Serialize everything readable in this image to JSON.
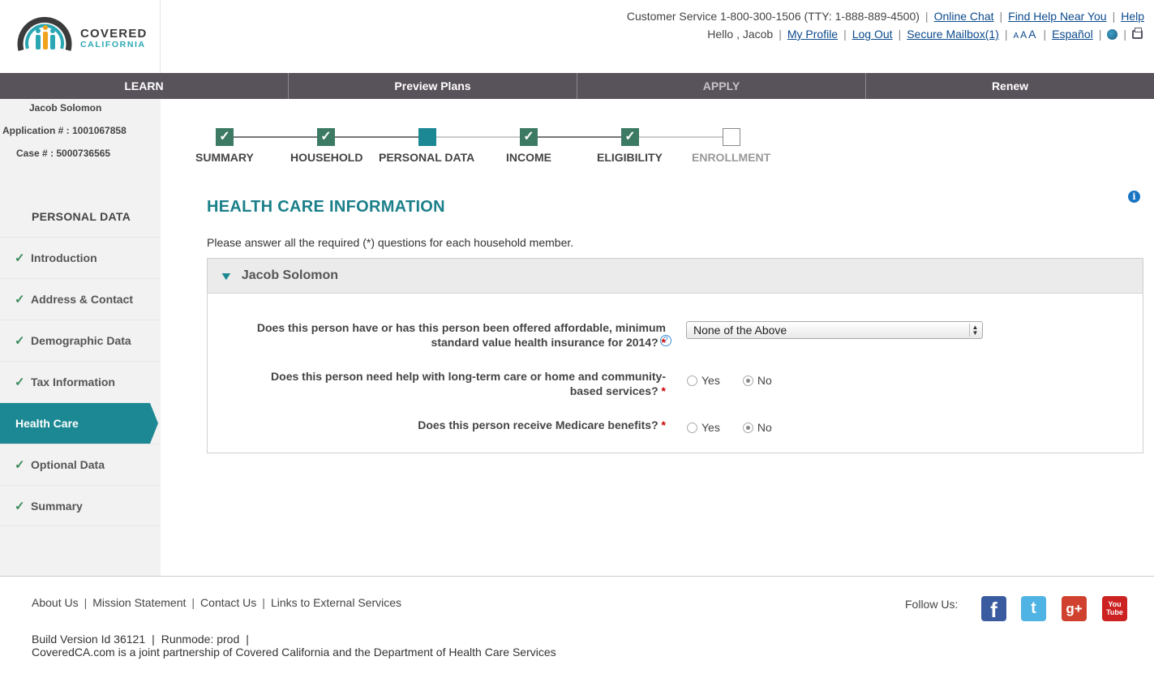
{
  "logo": {
    "line1": "COVERED",
    "line2": "CALIFORNIA"
  },
  "topbar": {
    "customer_service": "Customer Service 1-800-300-1506 (TTY: 1-888-889-4500)",
    "online_chat": "Online Chat",
    "find_help": "Find Help Near You",
    "help": "Help",
    "greeting": "Hello , Jacob",
    "my_profile": "My Profile",
    "log_out": "Log Out",
    "secure_mailbox": "Secure Mailbox(1)",
    "font_sizes": [
      "A",
      "A",
      "A"
    ],
    "espanol": "Español"
  },
  "nav": [
    {
      "label": "LEARN"
    },
    {
      "label": "Preview Plans"
    },
    {
      "label": "APPLY"
    },
    {
      "label": "Renew"
    }
  ],
  "sidebar": {
    "name": "Jacob Solomon",
    "application": "Application # : 1001067858",
    "case": "Case # : 5000736565",
    "heading": "PERSONAL DATA",
    "items": [
      {
        "label": "Introduction",
        "checked": true
      },
      {
        "label": "Address & Contact",
        "checked": true
      },
      {
        "label": "Demographic Data",
        "checked": true
      },
      {
        "label": "Tax Information",
        "checked": true
      },
      {
        "label": "Health Care",
        "active": true
      },
      {
        "label": "Optional Data",
        "checked": true
      },
      {
        "label": "Summary",
        "checked": true
      }
    ]
  },
  "progress": {
    "steps": [
      {
        "label": "SUMMARY",
        "state": "done"
      },
      {
        "label": "HOUSEHOLD",
        "state": "done"
      },
      {
        "label": "PERSONAL DATA",
        "state": "current"
      },
      {
        "label": "INCOME",
        "state": "done"
      },
      {
        "label": "ELIGIBILITY",
        "state": "done"
      },
      {
        "label": "ENROLLMENT",
        "state": "pending"
      }
    ]
  },
  "main": {
    "title": "HEALTH CARE INFORMATION",
    "instructions": "Please answer all the required (*) questions for each household member.",
    "member_name": "Jacob Solomon",
    "q1_line1": "Does this person have or has this person been offered affordable, minimum",
    "q1_line2": "standard value health insurance for 2014?",
    "q1_value": "None of the Above",
    "q2_line1": "Does this person need help with long-term care or home and community-",
    "q2_line2": "based services?",
    "q3": "Does this person receive Medicare benefits?",
    "yes": "Yes",
    "no": "No",
    "required_mark": "*"
  },
  "footer": {
    "links": [
      "About Us",
      "Mission Statement",
      "Contact Us",
      "Links to External Services"
    ],
    "follow_us": "Follow Us:",
    "build": "Build Version Id 36121",
    "runmode": "Runmode: prod",
    "partnership": "CoveredCA.com is a joint partnership of Covered California and the Department of Health Care Services",
    "social": {
      "facebook": "f",
      "twitter": "t",
      "gplus": "g+",
      "youtube_1": "You",
      "youtube_2": "Tube"
    }
  },
  "colors": {
    "accent": "#1b8893",
    "nav_bg": "#58525a",
    "done_green": "#3d7a64",
    "link": "#0c4a8c"
  }
}
